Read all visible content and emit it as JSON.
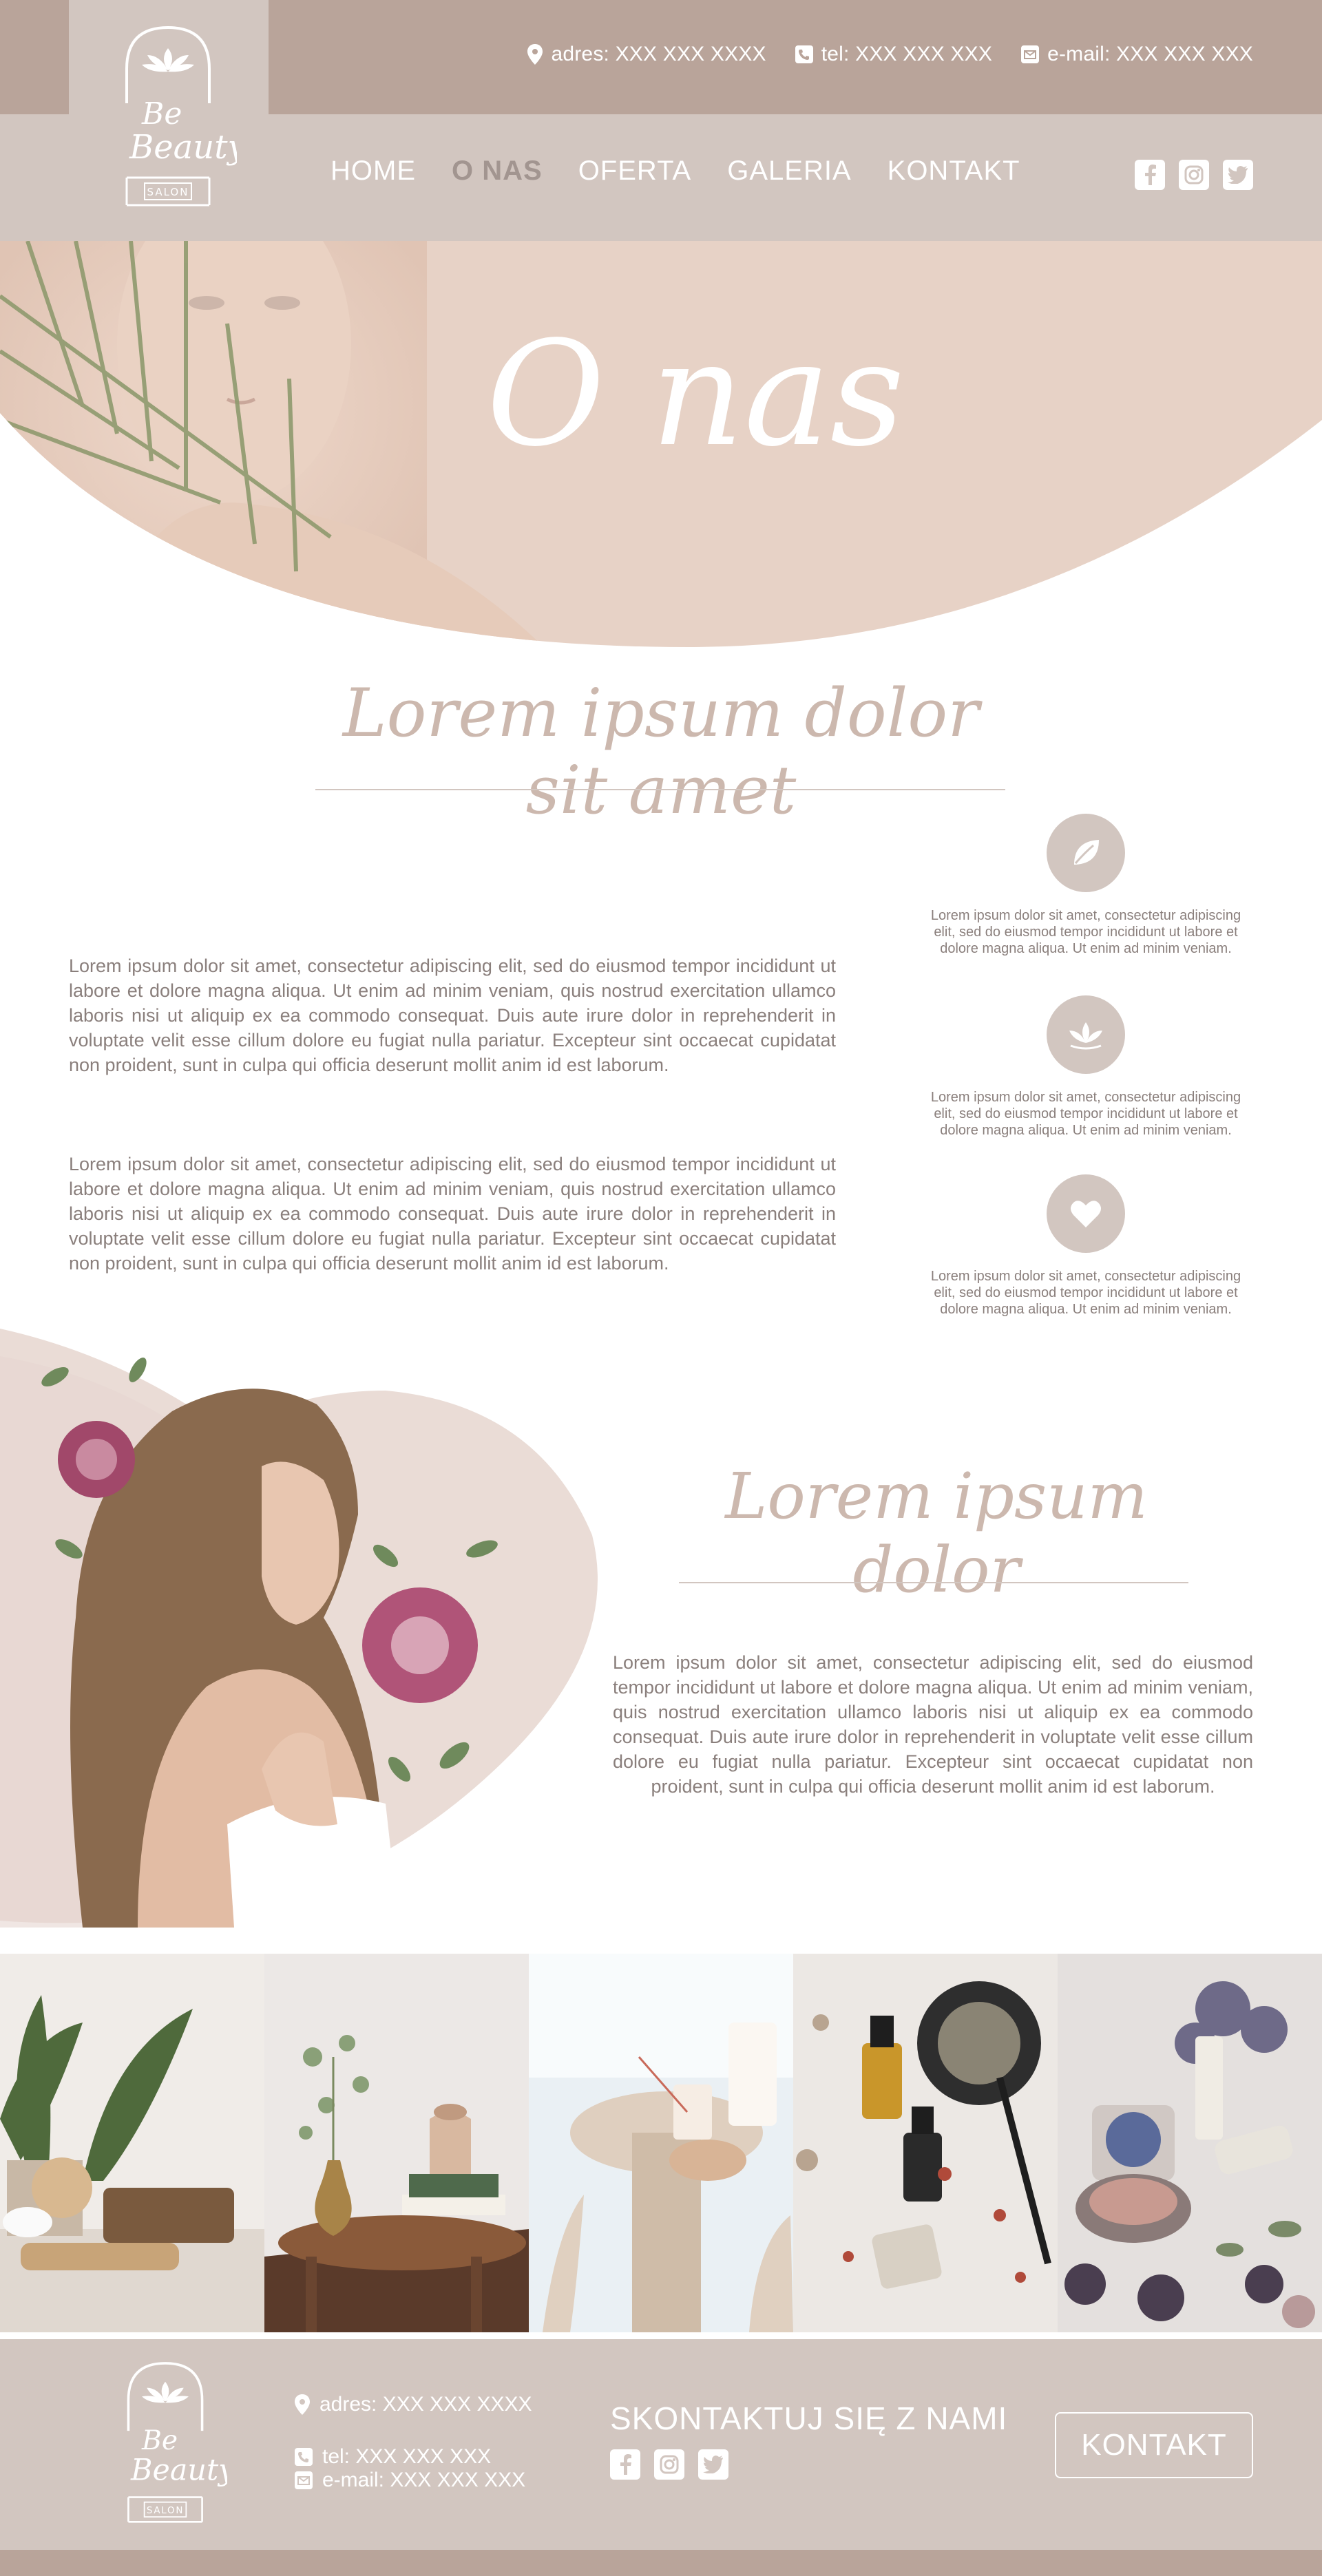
{
  "brand": {
    "logo_line1": "Be",
    "logo_line2": "Beauty",
    "logo_tag": "SALON"
  },
  "header": {
    "contact": {
      "address": "adres: XXX XXX XXXX",
      "phone": "tel: XXX XXX XXX",
      "email": "e-mail: XXX XXX XXX"
    },
    "nav": [
      {
        "label": "HOME"
      },
      {
        "label": "O NAS",
        "active": true
      },
      {
        "label": "OFERTA"
      },
      {
        "label": "GALERIA"
      },
      {
        "label": "KONTAKT"
      }
    ],
    "social": [
      "facebook-icon",
      "instagram-icon",
      "twitter-icon"
    ]
  },
  "hero": {
    "title": "O nas"
  },
  "section1": {
    "heading": "Lorem ipsum dolor sit amet",
    "paragraph1": "Lorem ipsum dolor sit amet, consectetur adipiscing elit, sed do eiusmod tempor incididunt ut labore et dolore magna aliqua. Ut enim ad minim veniam, quis nostrud exercitation ullamco laboris nisi ut aliquip ex ea commodo consequat. Duis aute irure dolor in reprehenderit in voluptate velit esse cillum dolore eu fugiat nulla pariatur. Excepteur sint occaecat cupidatat non proident, sunt in culpa qui officia deserunt mollit anim id est laborum.",
    "paragraph2": "Lorem ipsum dolor sit amet, consectetur adipiscing elit, sed do eiusmod tempor incididunt ut labore et dolore magna aliqua. Ut enim ad minim veniam, quis nostrud exercitation ullamco laboris nisi ut aliquip ex ea commodo consequat. Duis aute irure dolor in reprehenderit in voluptate velit esse cillum dolore eu fugiat nulla pariatur. Excepteur sint occaecat cupidatat non proident, sunt in culpa qui officia deserunt mollit anim id est laborum.",
    "features": [
      {
        "icon": "leaf-icon",
        "text": "Lorem ipsum dolor sit amet, consectetur adipiscing elit, sed do eiusmod tempor incididunt ut labore et dolore magna aliqua. Ut enim ad minim veniam."
      },
      {
        "icon": "lotus-icon",
        "text": "Lorem ipsum dolor sit amet, consectetur adipiscing elit, sed do eiusmod tempor incididunt ut labore et dolore magna aliqua. Ut enim ad minim veniam."
      },
      {
        "icon": "heart-icon",
        "text": "Lorem ipsum dolor sit amet, consectetur adipiscing elit, sed do eiusmod tempor incididunt ut labore et dolore magna aliqua. Ut enim ad minim veniam."
      }
    ]
  },
  "section2": {
    "heading": "Lorem ipsum dolor",
    "paragraph": "Lorem ipsum dolor sit amet, consectetur adipiscing elit, sed do eiusmod tempor incididunt ut labore et dolore magna aliqua. Ut enim ad minim veniam, quis nostrud exercitation ullamco laboris nisi ut aliquip ex ea commodo consequat. Duis aute irure dolor in reprehenderit in voluptate velit esse cillum dolore eu fugiat nulla pariatur. Excepteur sint occaecat cupidatat non proident, sunt in culpa qui officia deserunt mollit anim id est laborum."
  },
  "footer": {
    "address": "adres: XXX XXX XXXX",
    "phone": "tel: XXX XXX XXX",
    "email": "e-mail: XXX XXX XXX",
    "cta_title": "SKONTAKTUJ SIĘ Z NAMI",
    "button_label": "KONTAKT"
  },
  "colors": {
    "topbar": "#b9a49a",
    "nav_bg": "#d2c6c0",
    "accent": "#ccb8ae",
    "text": "#8a7f7c"
  }
}
